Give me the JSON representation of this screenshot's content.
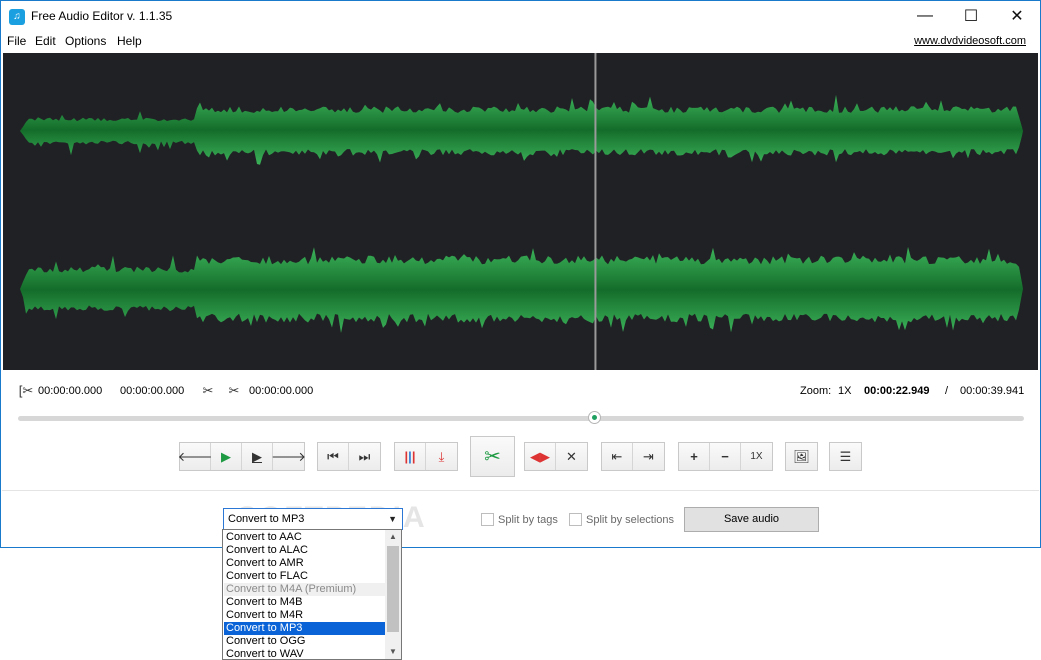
{
  "window": {
    "title": "Free Audio Editor v. 1.1.35",
    "minimize": "—",
    "maximize": "☐",
    "close": "✕"
  },
  "menu": {
    "items": [
      "File",
      "Edit",
      "Options",
      "Help"
    ],
    "site_link": "www.dvdvideosoft.com"
  },
  "timeline": {
    "start_time": "00:00:00.000",
    "end_time": "00:00:00.000",
    "duration": "00:00:00.000",
    "zoom_label": "Zoom:",
    "zoom_value": "1X",
    "current_time": "00:00:22.949",
    "separator": "/",
    "total_time": "00:00:39.941"
  },
  "playback": {
    "position_fraction": 0.574
  },
  "toolbar": {
    "zoom_reset_label": "1X"
  },
  "output": {
    "selected_format": "Convert to MP3",
    "split_by_tags_label": "Split by tags",
    "split_by_selections_label": "Split by selections",
    "save_label": "Save audio"
  },
  "format_options": [
    {
      "label": "Convert to AAC",
      "state": "normal"
    },
    {
      "label": "Convert to ALAC",
      "state": "normal"
    },
    {
      "label": "Convert to AMR",
      "state": "normal"
    },
    {
      "label": "Convert to FLAC",
      "state": "normal"
    },
    {
      "label": "Convert to M4A (Premium)",
      "state": "disabled"
    },
    {
      "label": "Convert to M4B",
      "state": "normal"
    },
    {
      "label": "Convert to M4R",
      "state": "normal"
    },
    {
      "label": "Convert to MP3",
      "state": "selected"
    },
    {
      "label": "Convert to OGG",
      "state": "normal"
    },
    {
      "label": "Convert to WAV",
      "state": "normal"
    }
  ],
  "watermark": "SOFTPEDIA",
  "colors": {
    "waveform": "#2e9e4a",
    "waveform_dark": "#1a6e2e",
    "background": "#202124",
    "selection": "#0a64d7",
    "accent": "#1979ca"
  }
}
